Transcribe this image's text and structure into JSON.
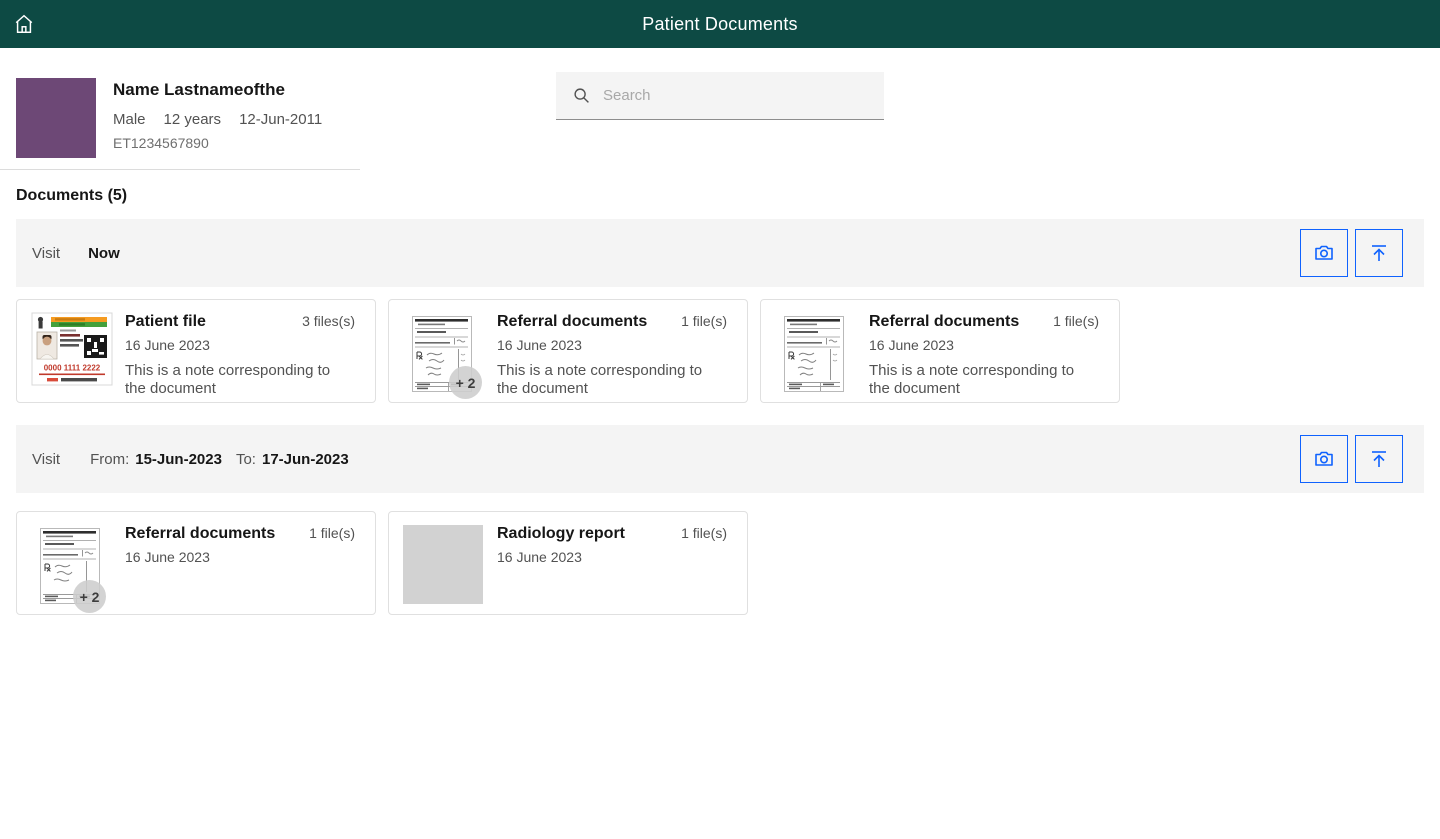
{
  "header": {
    "title": "Patient Documents"
  },
  "patient": {
    "name": "Name Lastnameofthe",
    "gender": "Male",
    "age": "12 years",
    "birthdate": "12-Jun-2011",
    "id": "ET1234567890"
  },
  "search": {
    "placeholder": "Search"
  },
  "documents_heading": "Documents (5)",
  "icons": {
    "home": "home-icon",
    "search": "search-icon",
    "camera": "camera-icon",
    "upload": "upload-icon"
  },
  "colors": {
    "header_teal": "#0d4a44",
    "avatar_purple": "#6d4876",
    "accent_blue": "#0f62fe",
    "bar_gray": "#f4f4f4"
  },
  "visits": [
    {
      "label": "Visit",
      "timing_now": "Now",
      "cards": [
        {
          "title": "Patient file",
          "count": "3 files(s)",
          "date": "16 June 2023",
          "note": "This is a note corresponding to the document",
          "thumbnail": "id-card",
          "id_card_number": "0000 1111 2222"
        },
        {
          "title": "Referral documents",
          "count": "1 file(s)",
          "date": "16 June 2023",
          "note": "This is a note corresponding to the document",
          "thumbnail": "prescription",
          "badge": "+ 2"
        },
        {
          "title": "Referral documents",
          "count": "1 file(s)",
          "date": "16 June 2023",
          "note": "This is a note corresponding to the document",
          "thumbnail": "prescription"
        }
      ]
    },
    {
      "label": "Visit",
      "from_label": "From:",
      "from_value": "15-Jun-2023",
      "to_label": "To:",
      "to_value": "17-Jun-2023",
      "cards": [
        {
          "title": "Referral documents",
          "count": "1 file(s)",
          "date": "16 June 2023",
          "thumbnail": "prescription",
          "badge": "+ 2"
        },
        {
          "title": "Radiology report",
          "count": "1 file(s)",
          "date": "16 June 2023",
          "thumbnail": "placeholder"
        }
      ]
    }
  ]
}
